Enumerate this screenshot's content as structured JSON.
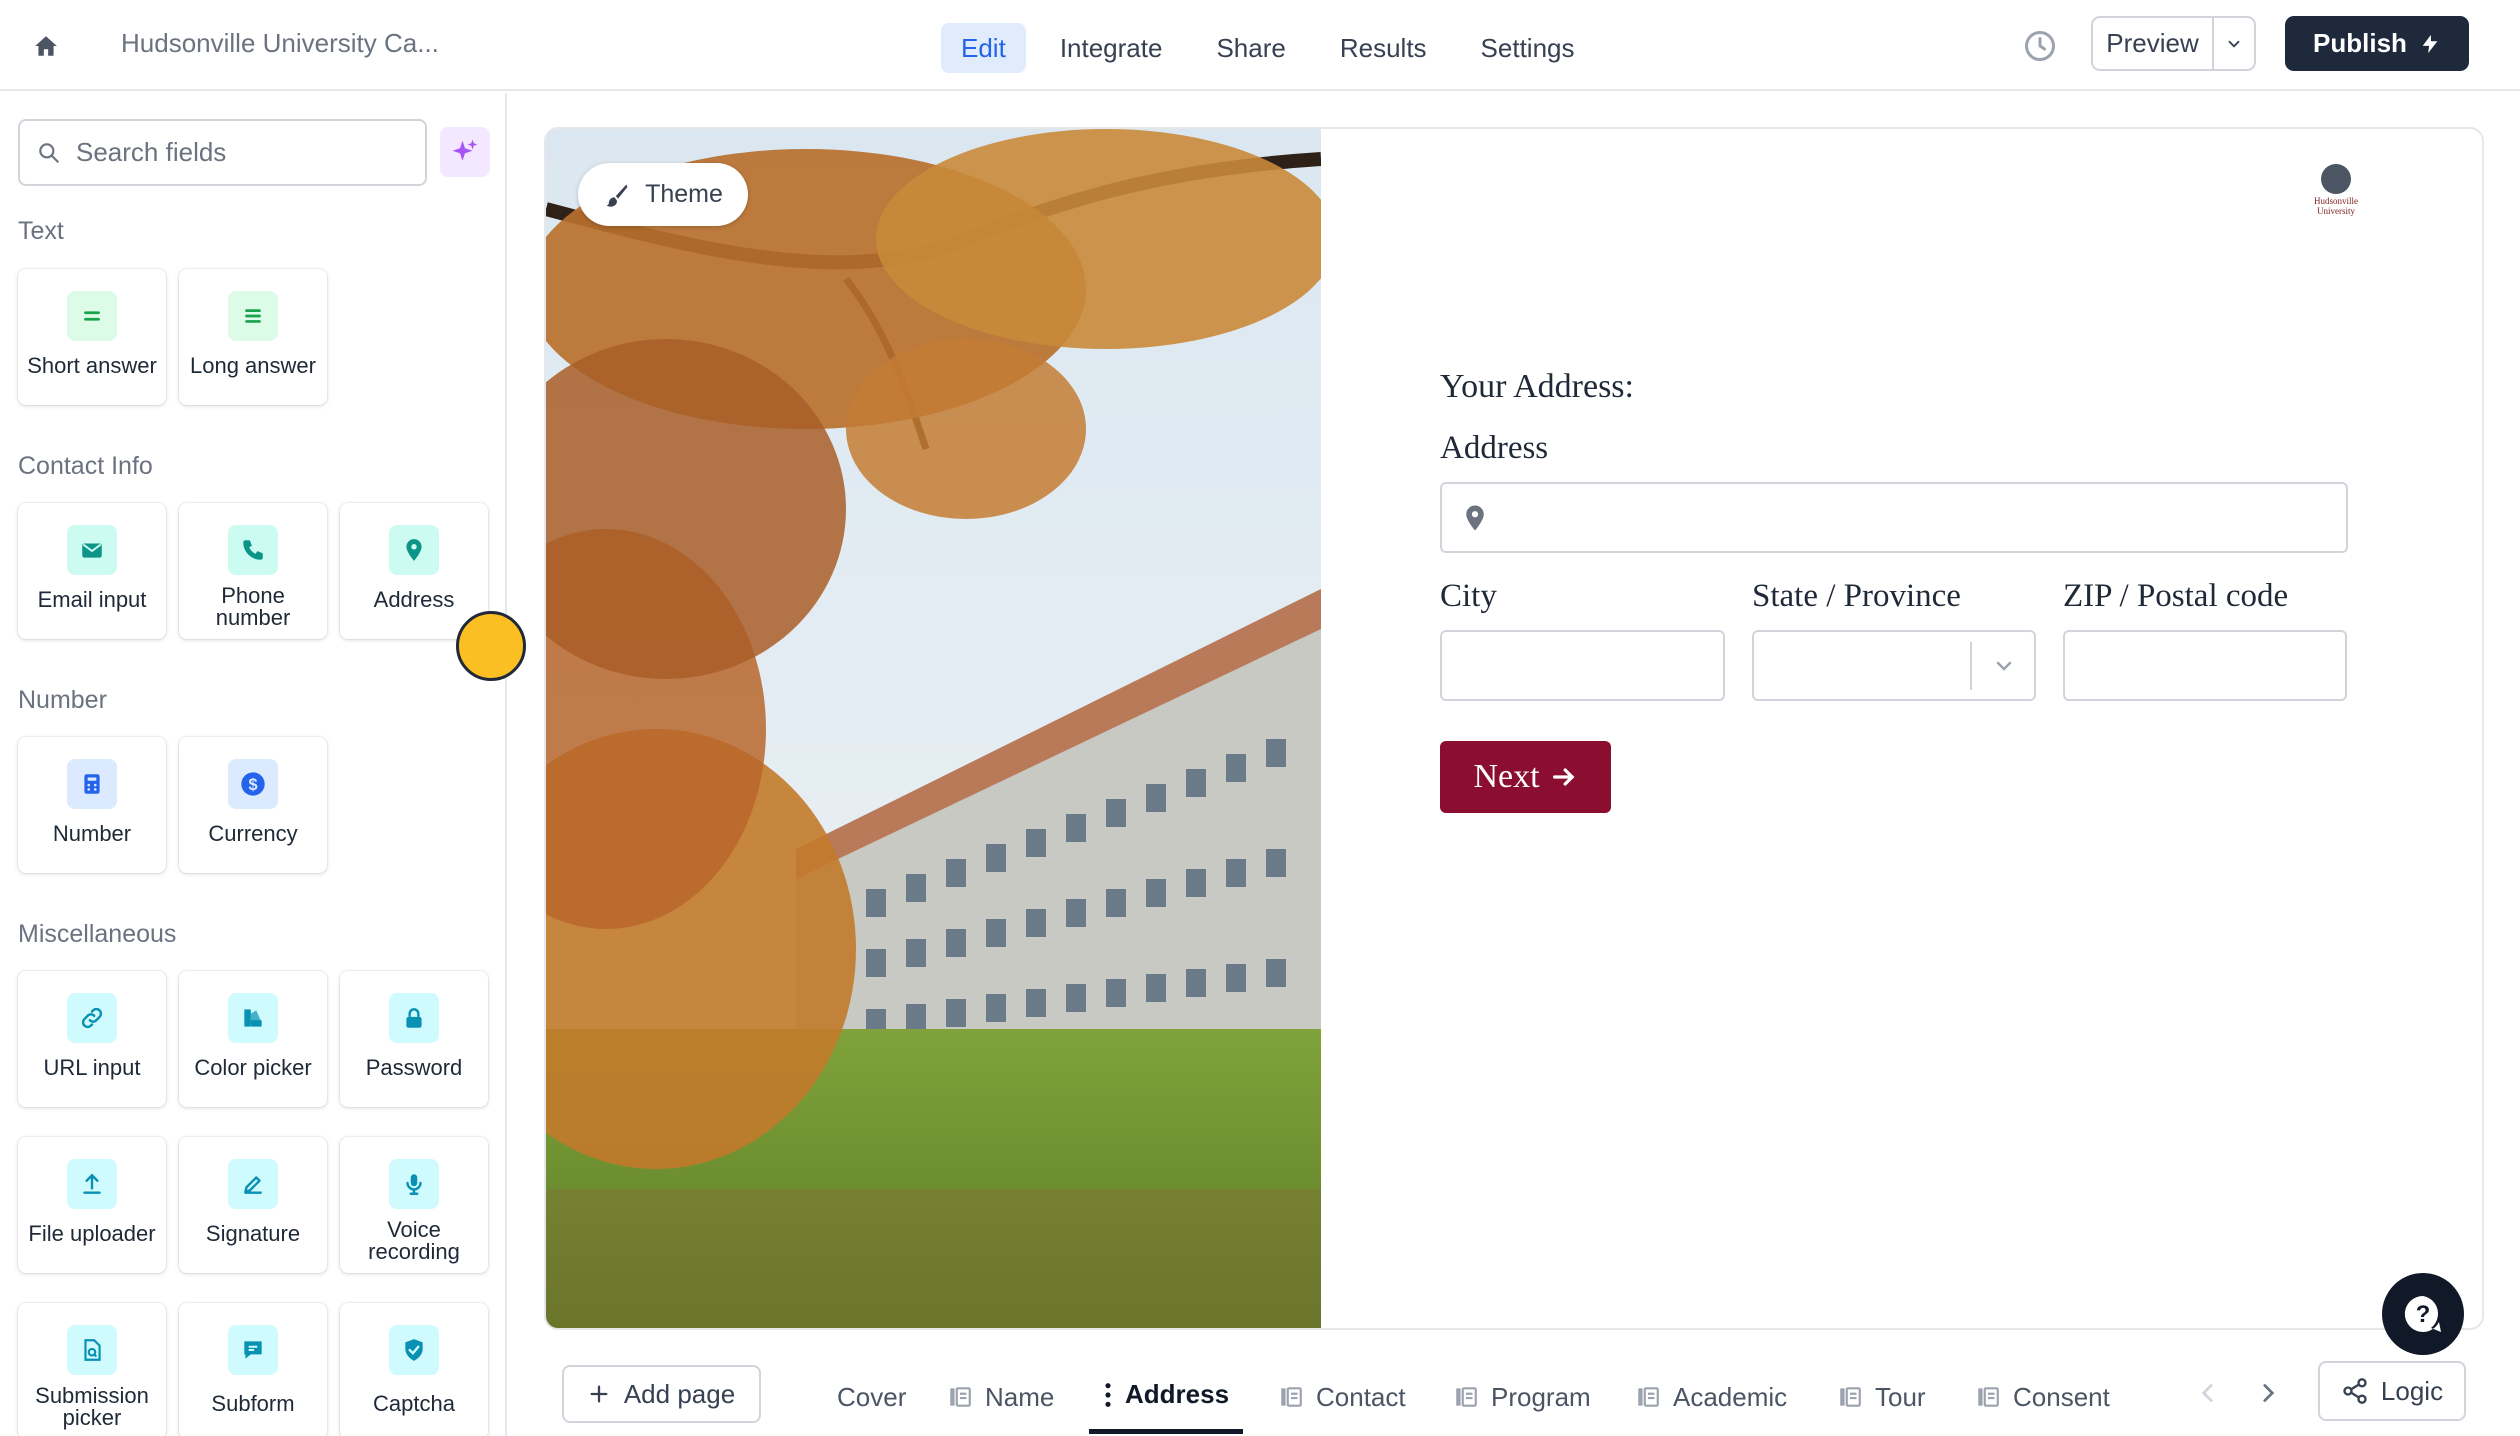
{
  "topbar": {
    "form_title": "Hudsonville University Ca...",
    "nav": [
      "Edit",
      "Integrate",
      "Share",
      "Results",
      "Settings"
    ],
    "active_nav": "Edit",
    "preview_label": "Preview",
    "publish_label": "Publish"
  },
  "sidebar": {
    "search_placeholder": "Search fields",
    "sections": [
      {
        "title": "Text",
        "items": [
          "Short answer",
          "Long answer"
        ]
      },
      {
        "title": "Contact Info",
        "items": [
          "Email input",
          "Phone number",
          "Address"
        ]
      },
      {
        "title": "Number",
        "items": [
          "Number",
          "Currency"
        ]
      },
      {
        "title": "Miscellaneous",
        "items": [
          "URL input",
          "Color picker",
          "Password",
          "File uploader",
          "Signature",
          "Voice recording",
          "Submission picker",
          "Subform",
          "Captcha"
        ]
      }
    ],
    "icons": {
      "Short answer": "short-text-icon",
      "Long answer": "long-text-icon",
      "Email input": "envelope-icon",
      "Phone number": "phone-icon",
      "Address": "map-pin-icon",
      "Number": "calculator-icon",
      "Currency": "dollar-icon",
      "URL input": "link-icon",
      "Color picker": "palette-icon",
      "Password": "lock-icon",
      "File uploader": "upload-icon",
      "Signature": "pen-icon",
      "Voice recording": "microphone-icon",
      "Submission picker": "file-search-icon",
      "Subform": "chat-icon",
      "Captcha": "shield-check-icon"
    }
  },
  "canvas": {
    "theme_label": "Theme",
    "logo_text": "Hudsonville University",
    "heading": "Your Address:",
    "address_label": "Address",
    "city_label": "City",
    "state_label": "State / Province",
    "zip_label": "ZIP / Postal code",
    "next_label": "Next"
  },
  "bottombar": {
    "add_page_label": "Add page",
    "pages": [
      "Cover",
      "Name",
      "Address",
      "Contact",
      "Program",
      "Academic",
      "Tour",
      "Consent"
    ],
    "active_page": "Address",
    "logic_label": "Logic"
  },
  "colors": {
    "accent": "#2563eb",
    "publish_bg": "#1e293b",
    "brand_button": "#8b0d2f",
    "ai_button": "#f3e8ff"
  }
}
